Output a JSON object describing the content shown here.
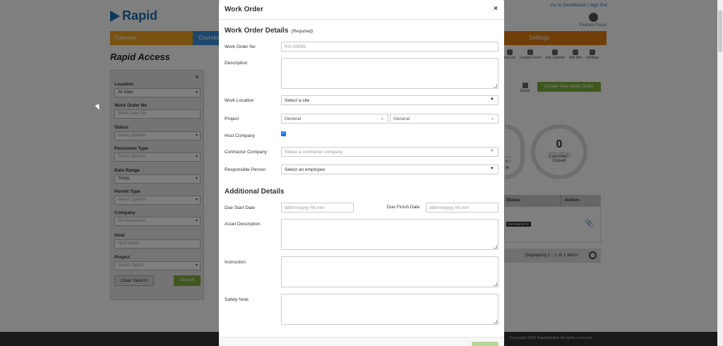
{
  "header": {
    "logo_text": "Rapid",
    "top_links": "Go to Dashboard | Sign Out",
    "feature_focus": "Feature Focus"
  },
  "nav": {
    "trainees": "Trainees",
    "courses": "Courses",
    "settings": "Settings"
  },
  "page_title": "Rapid Access",
  "toolbar": [
    {
      "label": "Ind List",
      "icon": "list-icon"
    },
    {
      "label": "Custom Form",
      "icon": "form-icon"
    },
    {
      "label": "Key Cabinet",
      "icon": "key-cabinet-icon"
    },
    {
      "label": "Site Info",
      "icon": "info-icon"
    },
    {
      "label": "Settings",
      "icon": "gear-icon"
    }
  ],
  "sidebar": {
    "location": {
      "label": "Location",
      "value": "All Sites"
    },
    "work_order_no": {
      "label": "Work Order No",
      "placeholder": "Work Order No"
    },
    "status": {
      "label": "Status",
      "value": "Select Options"
    },
    "personnel_type": {
      "label": "Personnel Type",
      "value": "Select Options"
    },
    "date_range": {
      "label": "Date Range",
      "value": "Today"
    },
    "permit_type": {
      "label": "Permit Type",
      "value": "Select Options"
    },
    "company": {
      "label": "Company",
      "value": "All Contractors"
    },
    "host": {
      "label": "Host",
      "placeholder": "Host Name"
    },
    "project": {
      "label": "Project",
      "value": "Select Option"
    },
    "clear_label": "Clear Search",
    "search_label": "Search"
  },
  "actions": {
    "excel": "Excel",
    "create": "Create New Work Order"
  },
  "summary": {
    "count": "0",
    "sub": "WORK ORDERS",
    "cancelled": "Cancelled /",
    "closed": "Closed",
    "g1_line1": "e /",
    "g1_line2": "te",
    "g1_sub": "ERS"
  },
  "table": {
    "col_status": "Status",
    "col_action": "Action",
    "row_status": "INCOMPLETE",
    "pager": "Displaying 1 - 1 of 1 items"
  },
  "footer": "Copyright 2023 RapidGlobal. All rights reserved.",
  "modal": {
    "title": "Work Order",
    "close": "×",
    "details_heading": "Work Order Details",
    "required": "(Required)",
    "work_order_no_label": "Work Order No",
    "work_order_no_placeholder": "RG-00096",
    "description_label": "Description",
    "work_location_label": "Work Location",
    "work_location_value": "Select a site",
    "project_label": "Project",
    "project_value1": "General",
    "project_value2": "General",
    "host_company_label": "Host Company",
    "contractor_company_label": "Contractor Company",
    "contractor_company_placeholder": "Select a contractor company",
    "responsible_person_label": "Responsible Person",
    "responsible_person_value": "Select an employee",
    "additional_heading": "Additional Details",
    "due_start_label": "Due Start Date",
    "due_start_placeholder": "dd/mm/yyyy hh:mm",
    "due_finish_label": "Due Finish Date",
    "due_finish_placeholder": "dd/mm/yyyy hh:mm",
    "asset_description_label": "Asset Description",
    "instruction_label": "Instruction",
    "safety_note_label": "Safety Note"
  }
}
